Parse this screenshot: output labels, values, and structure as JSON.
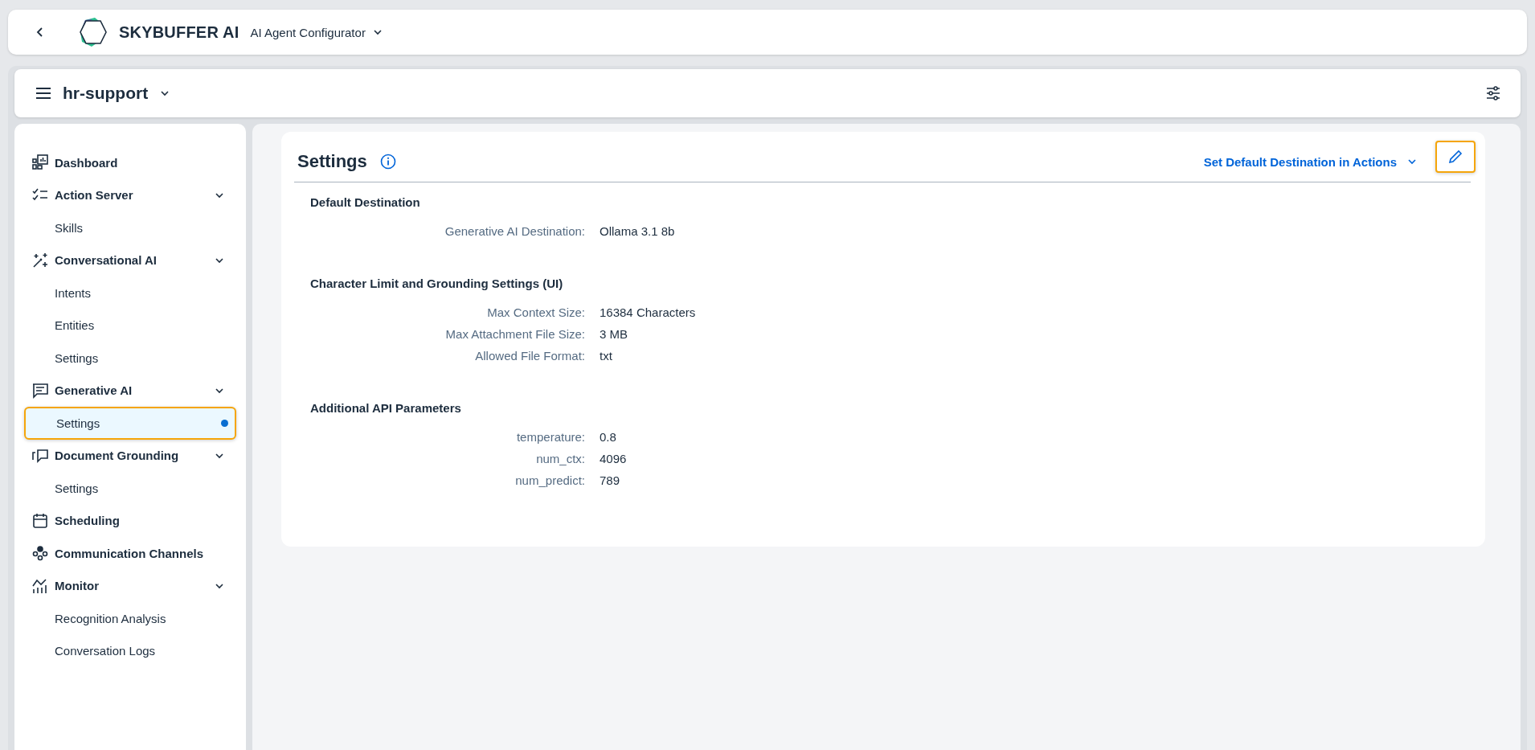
{
  "app_bar": {
    "brand": "SKYBUFFER AI",
    "app_title": "AI Agent Configurator"
  },
  "workspace": {
    "name": "hr-support"
  },
  "sidebar": {
    "items": [
      {
        "label": "Dashboard"
      },
      {
        "label": "Action Server",
        "expanded": true,
        "children": [
          {
            "label": "Skills",
            "selected": false
          }
        ]
      },
      {
        "label": "Conversational AI",
        "expanded": true,
        "children": [
          {
            "label": "Intents",
            "selected": false
          },
          {
            "label": "Entities",
            "selected": false
          },
          {
            "label": "Settings",
            "selected": false
          }
        ]
      },
      {
        "label": "Generative AI",
        "expanded": true,
        "children": [
          {
            "label": "Settings",
            "selected": true
          }
        ]
      },
      {
        "label": "Document Grounding",
        "expanded": true,
        "children": [
          {
            "label": "Settings",
            "selected": false
          }
        ]
      },
      {
        "label": "Scheduling"
      },
      {
        "label": "Communication Channels"
      },
      {
        "label": "Monitor",
        "expanded": true,
        "children": [
          {
            "label": "Recognition Analysis",
            "selected": false
          },
          {
            "label": "Conversation Logs",
            "selected": false
          }
        ]
      }
    ]
  },
  "settings": {
    "title": "Settings",
    "action_menu": "Set Default Destination in Actions",
    "edit_button": {
      "focused": true
    },
    "sections": [
      {
        "title": "Default Destination",
        "fields": [
          {
            "label": "Generative AI Destination:",
            "value": "Ollama 3.1 8b"
          }
        ]
      },
      {
        "title": "Character Limit and Grounding Settings (UI)",
        "fields": [
          {
            "label": "Max Context Size:",
            "value": "16384 Characters"
          },
          {
            "label": "Max Attachment File Size:",
            "value": "3 MB"
          },
          {
            "label": "Allowed File Format:",
            "value": "txt"
          }
        ]
      },
      {
        "title": "Additional API Parameters",
        "fields": [
          {
            "label": "temperature:",
            "value": "0.8"
          },
          {
            "label": "num_ctx:",
            "value": "4096"
          },
          {
            "label": "num_predict:",
            "value": "789"
          }
        ]
      }
    ]
  }
}
